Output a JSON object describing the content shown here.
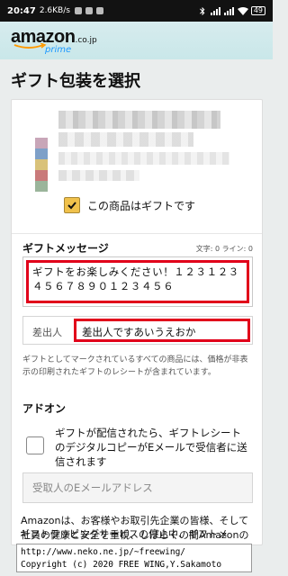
{
  "status_bar": {
    "time": "20:47",
    "speed": "2.6KB/s",
    "battery": "49"
  },
  "header": {
    "logo_word": "amazon",
    "logo_domain": ".co.jp",
    "logo_sub": "prime"
  },
  "page": {
    "title": "ギフト包装を選択"
  },
  "product": {
    "gift_checkbox_label": "この商品はギフトです"
  },
  "gift_message": {
    "title": "ギフトメッセージ",
    "counter": "文字: 0 ライン: 0",
    "text": "ギフトをお楽しみください！１２３１２３４５６７８９０１２３４５６",
    "sender_label": "差出人",
    "sender_value": "差出人ですあいうえおか",
    "note": "ギフトとしてマークされているすべての商品には、価格が非表示の印刷されたギフトのレシートが含まれています。"
  },
  "addon": {
    "title": "アドオン",
    "checkbox_label": "ギフトが配信されたら、ギフトレシートのデジタルコピーがEメールで受信者に送信されます",
    "email_placeholder": "受取人のEメールアドレス"
  },
  "notice": {
    "text": "Amazonは、お客様やお取引先企業の皆様、そして社員の健康と安全を重視、しばらくの間Amazonのギフトラッピングサービスを停止いたします。",
    "text2": "ギフトラッピングサービスの停止中、ギフトメ"
  },
  "credit": {
    "line1": "http://www.neko.ne.jp/~freewing/",
    "line2": "Copyright (c) 2020 FREE WING,Y.Sakamoto"
  },
  "colors": {
    "highlight": "#e1001a",
    "checkbox_accent": "#f0c14b",
    "header_bg": "#d2ebed"
  }
}
